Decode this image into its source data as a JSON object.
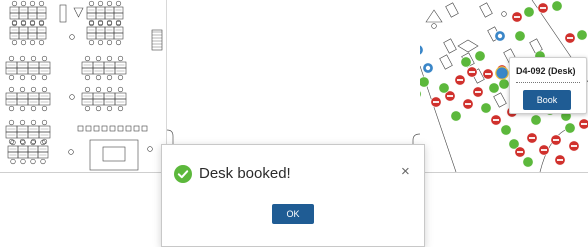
{
  "tooltip": {
    "desk_label": "D4-092 (Desk)",
    "book_button_label": "Book"
  },
  "dialog": {
    "message": "Desk booked!",
    "ok_button_label": "OK",
    "close_symbol": "×",
    "status_icon": "check-circle-icon"
  },
  "colors": {
    "available": "#5cb83c",
    "unavailable": "#d0312d",
    "booked_by_me": "#3a86c8",
    "primary_button": "#1f5c94",
    "success": "#5cb83c"
  }
}
